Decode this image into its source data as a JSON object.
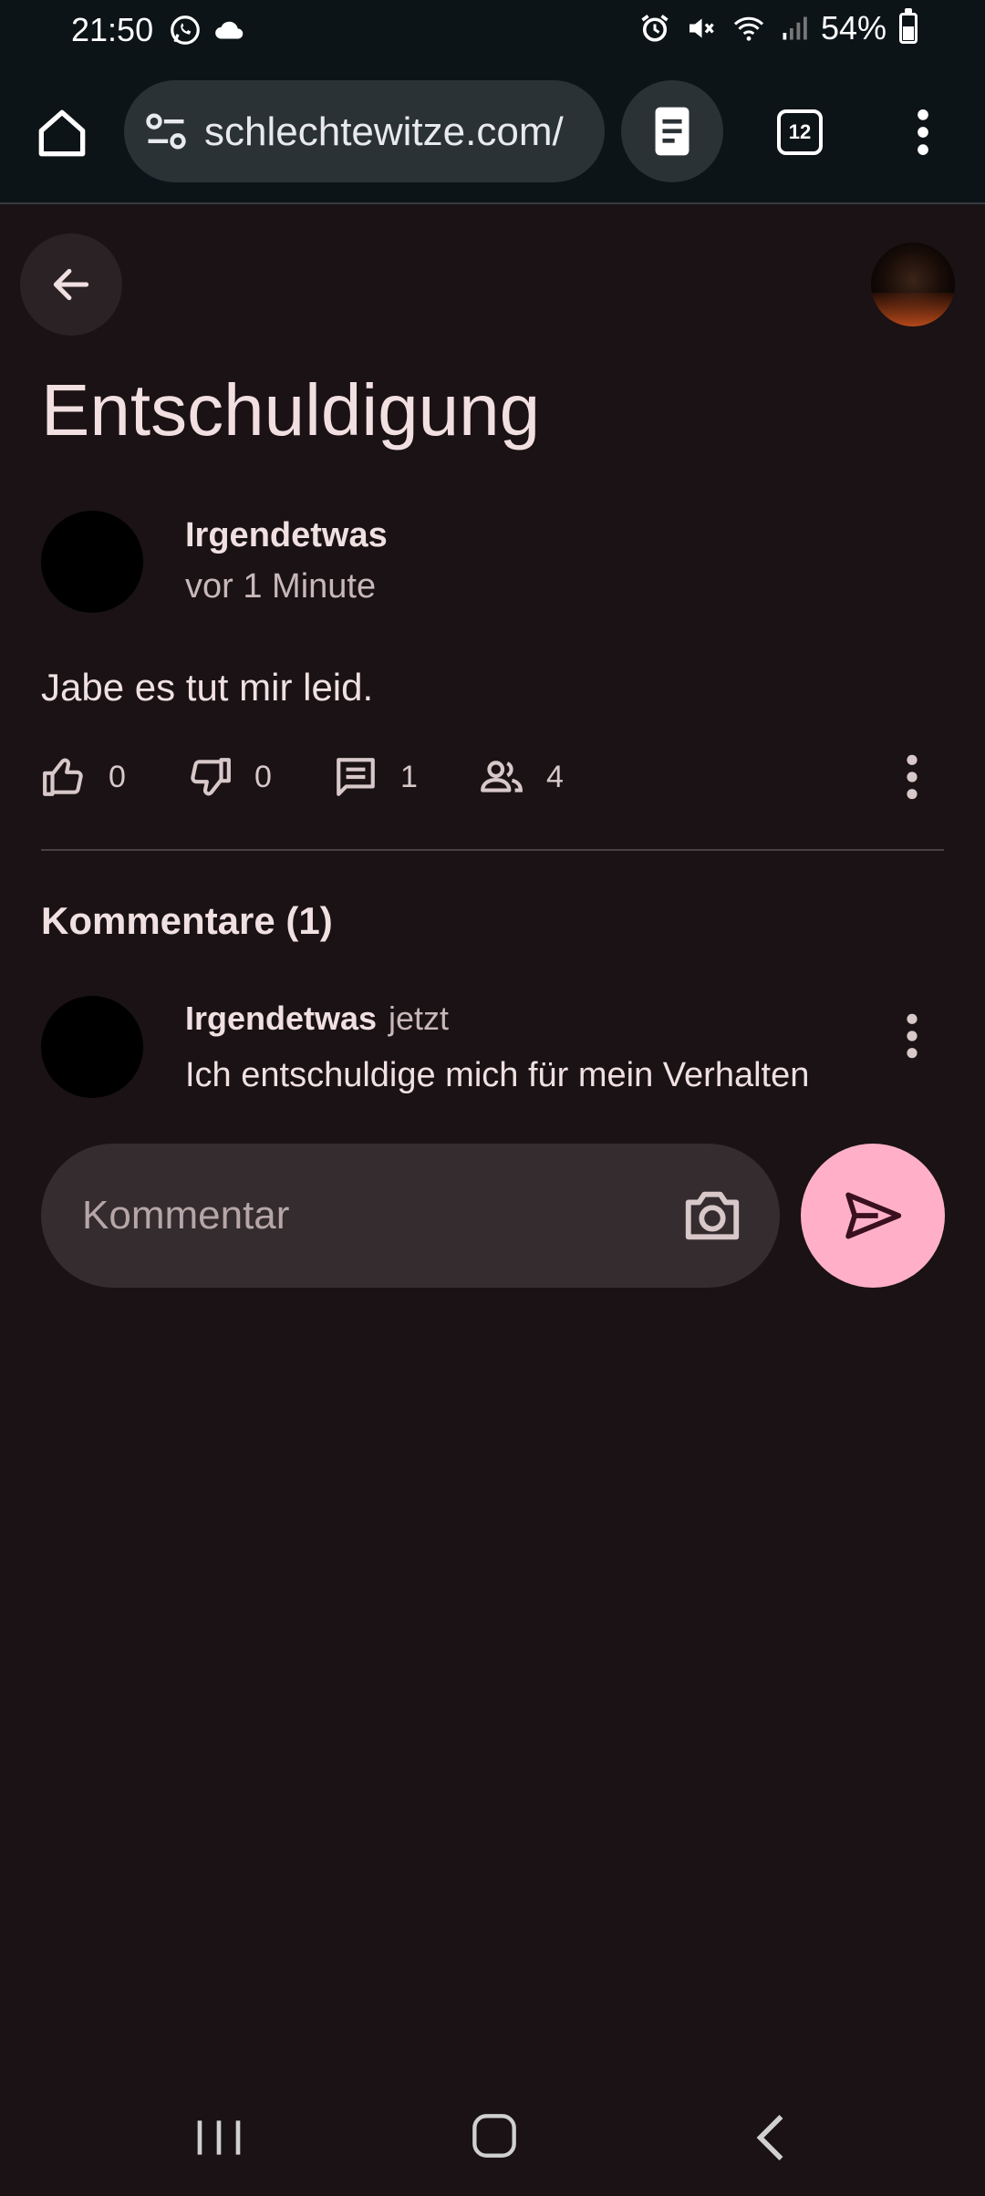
{
  "status_bar": {
    "time": "21:50",
    "battery": "54%",
    "battery_level": 0.54,
    "left_icons": [
      "whatsapp-icon",
      "cloud-icon"
    ],
    "right_icons": [
      "alarm-icon",
      "mute-icon",
      "wifi-icon",
      "signal-icon",
      "battery-icon"
    ]
  },
  "browser": {
    "url": "schlechtewitze.com/",
    "tab_count": "12"
  },
  "post": {
    "title": "Entschuldigung",
    "author": "Irgendetwas",
    "time": "vor 1 Minute",
    "body": "Jabe es tut mir leid.",
    "likes": "0",
    "dislikes": "0",
    "comments": "1",
    "viewers": "4"
  },
  "comments_section": {
    "title": "Kommentare (1)",
    "items": [
      {
        "author": "Irgendetwas",
        "time": "jetzt",
        "text": "Ich entschuldige mich für mein Verhalten"
      }
    ],
    "input_placeholder": "Kommentar"
  },
  "colors": {
    "background": "#1a1214",
    "toolbar": "#0d1418",
    "accent": "#ffb0c8",
    "text": "#f0e0e2"
  }
}
